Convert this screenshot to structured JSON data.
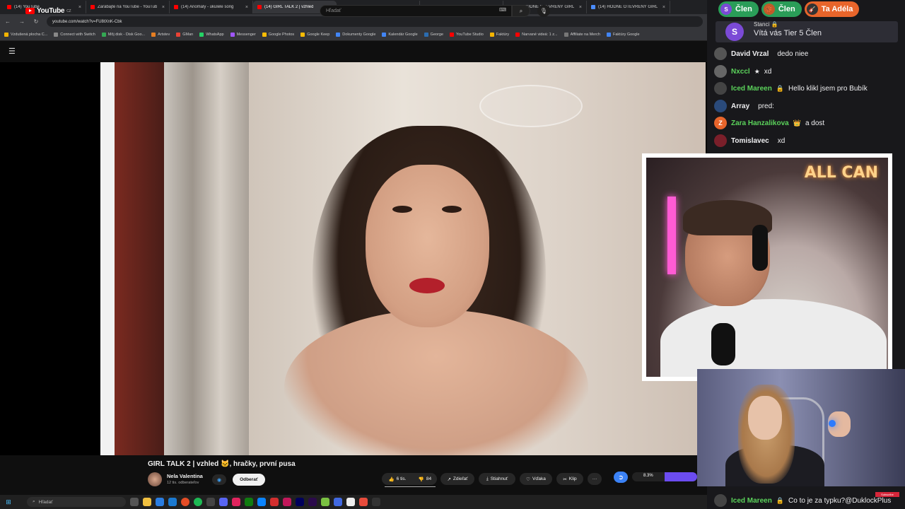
{
  "browser": {
    "tabs": [
      {
        "label": "(14) YouTube",
        "color": "#ff0000",
        "active": false
      },
      {
        "label": "Zarábajte na YouTube - YouTub",
        "color": "#ff0000",
        "active": false
      },
      {
        "label": "(14) Anomaly - ukulele song",
        "color": "#ff0000",
        "active": false
      },
      {
        "label": "(14) GIRL TALK 2 | vzhled",
        "color": "#ff0000",
        "active": true
      },
      {
        "label": "(14) HODNÉ OTEVŘENÝ GIRL",
        "color": "#4a8cff",
        "active": false
      },
      {
        "label": "(14) HODNÉ OTEVŘENÝ GIRL",
        "color": "#4a8cff",
        "active": false
      },
      {
        "label": "(14) HODNÉ OTEVŘENÝ GIRL",
        "color": "#4a8cff",
        "active": false
      },
      {
        "label": "(14) HODNÉ OTEVŘENÝ GIRL",
        "color": "#4a8cff",
        "active": false
      }
    ],
    "url": "youtube.com/watch?v=FU8tXnK-Cbk",
    "bookmarks": [
      {
        "label": "Vzdušená plocha C...",
        "color": "#f4b400"
      },
      {
        "label": "Connect with Switch",
        "color": "#888888"
      },
      {
        "label": "Môj disk - Disk Goo...",
        "color": "#34a853"
      },
      {
        "label": "Artstev",
        "color": "#e67e22"
      },
      {
        "label": "GMan",
        "color": "#ea4335"
      },
      {
        "label": "WhatsApp",
        "color": "#25d366"
      },
      {
        "label": "Messenger",
        "color": "#a056ff"
      },
      {
        "label": "Google Photos",
        "color": "#fbbc05"
      },
      {
        "label": "Google Keep",
        "color": "#fbbc05"
      },
      {
        "label": "Dokumenty Google",
        "color": "#4285f4"
      },
      {
        "label": "Kalendár Google",
        "color": "#4285f4"
      },
      {
        "label": "George",
        "color": "#2b6cb0"
      },
      {
        "label": "YouTube Studio",
        "color": "#ff0000"
      },
      {
        "label": "Faktúry",
        "color": "#f4b400"
      },
      {
        "label": "Narvané videá: 1 z...",
        "color": "#ff0000"
      },
      {
        "label": "Affiliate na Merch",
        "color": "#777777"
      },
      {
        "label": "Faktúry Google",
        "color": "#4285f4"
      }
    ]
  },
  "youtube": {
    "logo_text": "YouTube",
    "logo_sup": "CZ",
    "search_placeholder": "Hľadať",
    "video_title": "GIRL TALK 2 | vzhled 🐱, hračky, první pusa",
    "channel_name": "Nela Valentina",
    "channel_subs": "12 tis. odberateľov",
    "subscribe_label": "Odberať",
    "actions": {
      "likes": "6 tis.",
      "dislikes": "84",
      "share": "Zdieľať",
      "download": "Stiahnuť",
      "thanks": "Vďaka",
      "clip": "Klip",
      "more": "···"
    }
  },
  "chat": {
    "badges": [
      {
        "label": "Člen",
        "bg": "#2a9d58",
        "icon": "S",
        "icon_bg": "#7b4ad6"
      },
      {
        "label": "Člen",
        "bg": "#2a9d58",
        "icon": "🏀",
        "icon_bg": "#c25a2a"
      },
      {
        "label": "Ta Adéla",
        "bg": "#e8652b",
        "icon": "🎸",
        "icon_bg": "#333333"
      }
    ],
    "tier": {
      "user": "Stanci 🔒",
      "text": "Vítá vás Tier 5 Člen",
      "avatar": "S"
    },
    "messages": [
      {
        "user": "David Vrzal",
        "text": "dedo niee",
        "color": "#efeff1",
        "icon": "",
        "avatar_bg": "#555555",
        "avatar": ""
      },
      {
        "user": "Nxccl",
        "text": "xd",
        "color": "#5bd35b",
        "icon": "★",
        "avatar_bg": "#666666",
        "avatar": ""
      },
      {
        "user": "Iced Mareen",
        "text": "Hello klikl jsem pro Bubík",
        "color": "#5bd35b",
        "icon": "🔒",
        "avatar_bg": "#444444",
        "avatar": ""
      },
      {
        "user": "Array",
        "text": "pred:",
        "color": "#efeff1",
        "icon": "",
        "avatar_bg": "#2a4a7a",
        "avatar": ""
      },
      {
        "user": "Zara Hanzalikova",
        "text": "a dost",
        "color": "#5bd35b",
        "icon": "👑",
        "avatar_bg": "#e8652b",
        "avatar": "Z"
      },
      {
        "user": "Tomislavec",
        "text": "xd",
        "color": "#efeff1",
        "icon": "",
        "avatar_bg": "#7a1f2a",
        "avatar": ""
      },
      {
        "user": "Iced Mareen",
        "text": "Co to je za typku?@DuklockPlus",
        "color": "#5bd35b",
        "icon": "🔒",
        "avatar_bg": "#444444",
        "avatar": ""
      }
    ]
  },
  "webcam": {
    "neon_text": "ALL CAN"
  },
  "overlay": {
    "progress_label": "8.3%",
    "subscribe_tag": "Subscribe"
  },
  "taskbar": {
    "search_placeholder": "Hľadať"
  }
}
